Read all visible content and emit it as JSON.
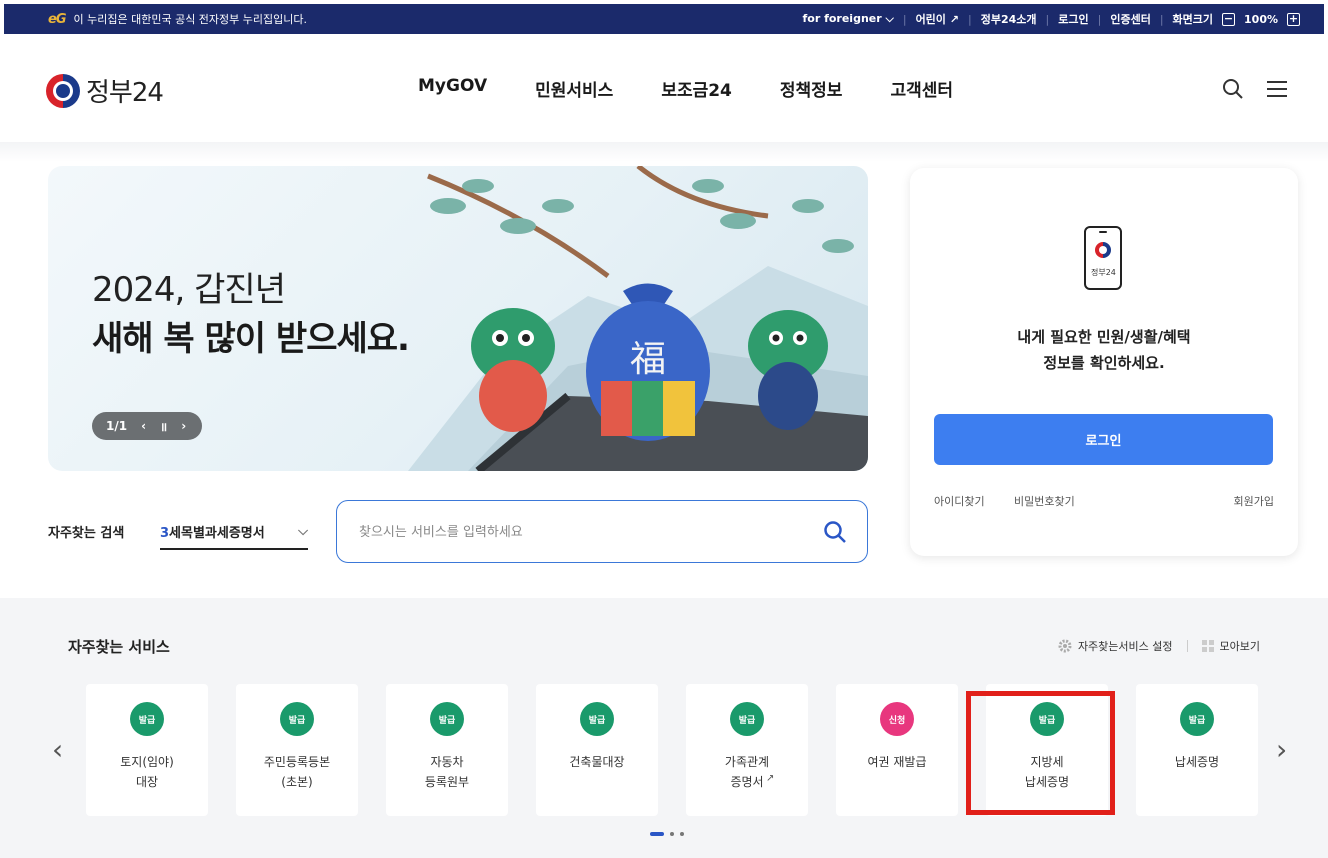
{
  "gov_bar": {
    "brand_mark": "eG",
    "text": "이 누리집은 대한민국 공식 전자정부 누리집입니다.",
    "links": [
      "for foreigner",
      "어린이",
      "정부24소개",
      "로그인",
      "인증센터",
      "화면크기"
    ],
    "zoom": "100%"
  },
  "header": {
    "logo_text": "정부24",
    "nav": [
      "MyGOV",
      "민원서비스",
      "보조금24",
      "정책정보",
      "고객센터"
    ],
    "icons": [
      "search-icon",
      "menu-icon"
    ]
  },
  "banner": {
    "line1": "2024, 갑진년",
    "line2": "새해 복 많이 받으세요.",
    "pager": "1/1"
  },
  "frequent_search": {
    "label": "자주찾는 검색",
    "keyword_num": "3",
    "keyword_text": "세목별과세증명서",
    "placeholder": "찾으시는 서비스를 입력하세요"
  },
  "login_card": {
    "phone_label": "정부24",
    "message_line1": "내게 필요한 민원/생활/혜택",
    "message_line2": "정보를 확인하세요.",
    "login_button": "로그인",
    "find_id": "아이디찾기",
    "find_pw": "비밀번호찾기",
    "signup": "회원가입"
  },
  "services": {
    "title": "자주찾는 서비스",
    "settings": "자주찾는서비스 설정",
    "view_all": "모아보기",
    "items": [
      {
        "badge": "발급",
        "name": "토지(임야)\n대장"
      },
      {
        "badge": "발급",
        "name": "주민등록등본\n(초본)"
      },
      {
        "badge": "발급",
        "name": "자동차\n등록원부"
      },
      {
        "badge": "발급",
        "name": "건축물대장"
      },
      {
        "badge": "발급",
        "name": "가족관계\n증명서"
      },
      {
        "badge": "신청",
        "name": "여권 재발급"
      },
      {
        "badge": "발급",
        "name": "지방세\n납세증명"
      },
      {
        "badge": "발급",
        "name": "납세증명"
      }
    ]
  },
  "colors": {
    "gov_bar": "#1b2a6b",
    "primary": "#3d7ef0",
    "badge_issue": "#1a9a6b",
    "badge_apply": "#e8377e",
    "highlight": "#e1201a"
  }
}
